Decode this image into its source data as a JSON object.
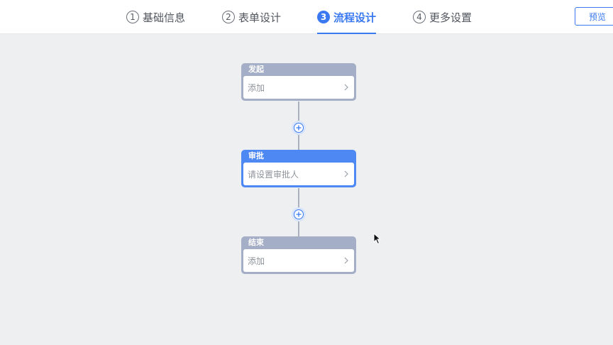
{
  "steps": [
    {
      "number": "1",
      "label": "基础信息",
      "active": false
    },
    {
      "number": "2",
      "label": "表单设计",
      "active": false
    },
    {
      "number": "3",
      "label": "流程设计",
      "active": true
    },
    {
      "number": "4",
      "label": "更多设置",
      "active": false
    }
  ],
  "header": {
    "preview_label": "预览"
  },
  "flow": {
    "nodes": [
      {
        "title": "发起",
        "placeholder": "添加",
        "type": "start"
      },
      {
        "title": "审批",
        "placeholder": "请设置审批人",
        "type": "approver"
      },
      {
        "title": "结束",
        "placeholder": "添加",
        "type": "end"
      }
    ],
    "add_icon": "plus-icon",
    "node_arrow_icon": "chevron-right-icon"
  },
  "colors": {
    "accent": "#3a79f0",
    "node_default": "#a4aec6",
    "node_approver": "#4e88f2",
    "canvas_bg": "#eeeff1"
  }
}
